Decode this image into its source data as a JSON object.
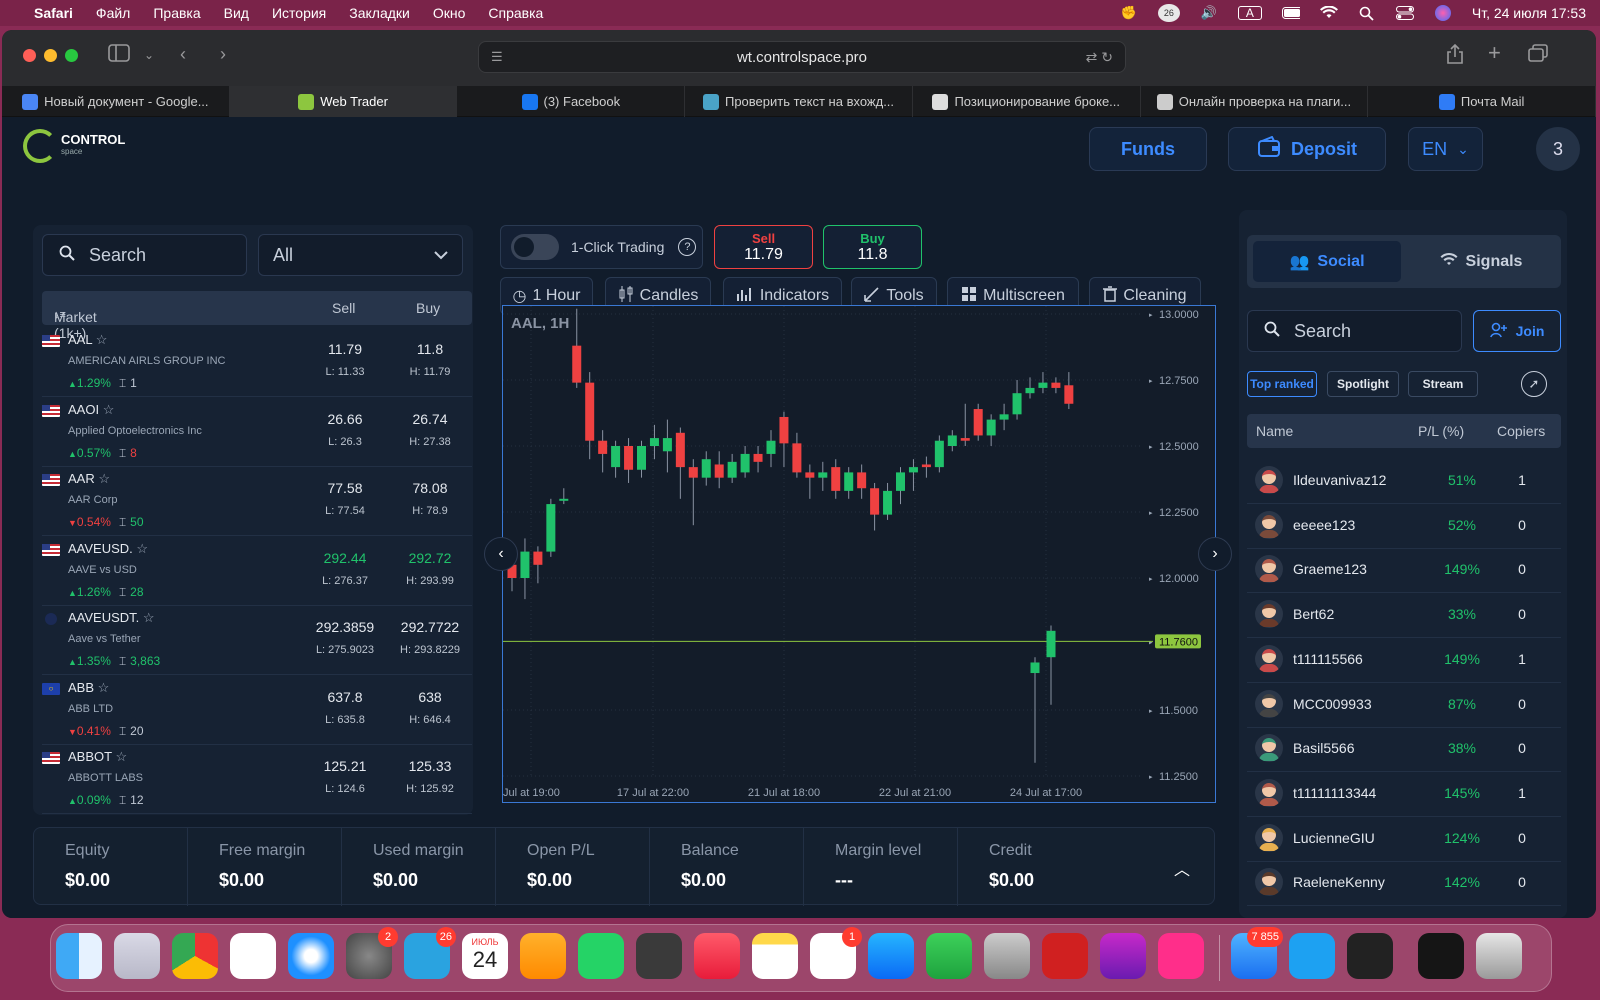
{
  "menubar": {
    "app": "Safari",
    "items": [
      "Файл",
      "Правка",
      "Вид",
      "История",
      "Закладки",
      "Окно",
      "Справка"
    ],
    "datetime": "Чт, 24 июля  17:53",
    "input_source": "A"
  },
  "browser": {
    "url": "wt.controlspace.pro",
    "tabs": [
      {
        "label": "Новый документ - Google...",
        "active": false,
        "color": "#4a86f5"
      },
      {
        "label": "Web Trader",
        "active": true,
        "color": "#8dc63f"
      },
      {
        "label": "(3) Facebook",
        "active": false,
        "color": "#1877f2"
      },
      {
        "label": "Проверить текст на вхожд...",
        "active": false,
        "color": "#4aa3c7"
      },
      {
        "label": "Позиционирование броке...",
        "active": false,
        "color": "#dddddd"
      },
      {
        "label": "Онлайн проверка на плаги...",
        "active": false,
        "color": "#cccccc"
      },
      {
        "label": "Почта Mail",
        "active": false,
        "color": "#2f7cf6"
      }
    ]
  },
  "header": {
    "logo_text": "CONTROL",
    "logo_sub": "space",
    "funds_label": "Funds",
    "deposit_label": "Deposit",
    "lang_label": "EN",
    "avatar_label": "3"
  },
  "market": {
    "search_placeholder": "Search",
    "filter_value": "All",
    "col_market": "Market (1k+)",
    "col_sell": "Sell",
    "col_buy": "Buy",
    "rows": [
      {
        "symbol": "AAL",
        "name": "AMERICAN AIRLS GROUP INC",
        "change": "1.29%",
        "dir": "up",
        "count": "1",
        "count_color": "#c0c8d4",
        "sell": "11.79",
        "buy": "11.8",
        "low": "L: 11.33",
        "high": "H: 11.79",
        "price_color": "#e4e8ee",
        "flag": "us"
      },
      {
        "symbol": "AAOI",
        "name": "Applied Optoelectronics Inc",
        "change": "0.57%",
        "dir": "up",
        "count": "8",
        "count_color": "#ef4141",
        "sell": "26.66",
        "buy": "26.74",
        "low": "L: 26.3",
        "high": "H: 27.38",
        "price_color": "#e4e8ee",
        "flag": "us"
      },
      {
        "symbol": "AAR",
        "name": "AAR Corp",
        "change": "0.54%",
        "dir": "down",
        "count": "50",
        "count_color": "#20c26b",
        "sell": "77.58",
        "buy": "78.08",
        "low": "L: 77.54",
        "high": "H: 78.9",
        "price_color": "#e4e8ee",
        "flag": "us"
      },
      {
        "symbol": "AAVEUSD.",
        "name": "AAVE vs USD",
        "change": "1.26%",
        "dir": "up",
        "count": "28",
        "count_color": "#20c26b",
        "sell": "292.44",
        "buy": "292.72",
        "low": "L: 276.37",
        "high": "H: 293.99",
        "price_color": "#20c26b",
        "flag": "us"
      },
      {
        "symbol": "AAVEUSDT.",
        "name": "Aave vs Tether",
        "change": "1.35%",
        "dir": "up",
        "count": "3,863",
        "count_color": "#20c26b",
        "sell": "292.3859",
        "buy": "292.7722",
        "low": "L: 275.9023",
        "high": "H: 293.8229",
        "price_color": "#e4e8ee",
        "flag": "crypto"
      },
      {
        "symbol": "ABB",
        "name": "ABB LTD",
        "change": "0.41%",
        "dir": "down",
        "count": "20",
        "count_color": "#c0c8d4",
        "sell": "637.8",
        "buy": "638",
        "low": "L: 635.8",
        "high": "H: 646.4",
        "price_color": "#e4e8ee",
        "flag": "eu"
      },
      {
        "symbol": "ABBOT",
        "name": "ABBOTT LABS",
        "change": "0.09%",
        "dir": "up",
        "count": "12",
        "count_color": "#c0c8d4",
        "sell": "125.21",
        "buy": "125.33",
        "low": "L: 124.6",
        "high": "H: 125.92",
        "price_color": "#e4e8ee",
        "flag": "us"
      }
    ]
  },
  "trade": {
    "one_click_label": "1-Click Trading",
    "one_click_enabled": false,
    "sell_label": "Sell",
    "sell_price": "11.79",
    "buy_label": "Buy",
    "buy_price": "11.8",
    "tools": [
      "1 Hour",
      "Candles",
      "Indicators",
      "Tools",
      "Multiscreen",
      "Cleaning"
    ]
  },
  "chart_data": {
    "type": "candlestick",
    "title": "AAL, 1H",
    "y_ticks": [
      "13.0000",
      "12.7500",
      "12.5000",
      "12.2500",
      "12.0000",
      "11.7600",
      "11.5000",
      "11.2500"
    ],
    "ylim": [
      11.25,
      13.0
    ],
    "x_ticks": [
      "Jul at 19:00",
      "17 Jul at 22:00",
      "21 Jul at 18:00",
      "22 Jul at 21:00",
      "24 Jul at 17:00"
    ],
    "current_price": 11.76,
    "current_price_label": "11.7600",
    "up_color": "#20c26b",
    "down_color": "#ef4141",
    "candles": [
      [
        12.05,
        12.0,
        12.08,
        11.95
      ],
      [
        12.0,
        12.1,
        12.15,
        11.92
      ],
      [
        12.1,
        12.05,
        12.12,
        11.98
      ],
      [
        12.1,
        12.28,
        12.3,
        12.08
      ],
      [
        12.3,
        12.3,
        12.34,
        12.28
      ],
      [
        12.88,
        12.74,
        13.02,
        12.72
      ],
      [
        12.74,
        12.52,
        12.78,
        12.45
      ],
      [
        12.52,
        12.47,
        12.56,
        12.4
      ],
      [
        12.42,
        12.5,
        12.52,
        12.38
      ],
      [
        12.5,
        12.41,
        12.53,
        12.36
      ],
      [
        12.41,
        12.5,
        12.52,
        12.38
      ],
      [
        12.5,
        12.53,
        12.58,
        12.45
      ],
      [
        12.48,
        12.53,
        12.6,
        12.4
      ],
      [
        12.55,
        12.42,
        12.57,
        12.3
      ],
      [
        12.42,
        12.38,
        12.45,
        12.2
      ],
      [
        12.38,
        12.45,
        12.48,
        12.35
      ],
      [
        12.43,
        12.38,
        12.48,
        12.34
      ],
      [
        12.38,
        12.44,
        12.47,
        12.36
      ],
      [
        12.4,
        12.47,
        12.5,
        12.38
      ],
      [
        12.47,
        12.44,
        12.5,
        12.4
      ],
      [
        12.47,
        12.52,
        12.56,
        12.42
      ],
      [
        12.61,
        12.51,
        12.63,
        12.42
      ],
      [
        12.51,
        12.4,
        12.55,
        12.38
      ],
      [
        12.4,
        12.38,
        12.43,
        12.3
      ],
      [
        12.38,
        12.4,
        12.44,
        12.33
      ],
      [
        12.42,
        12.33,
        12.45,
        12.3
      ],
      [
        12.33,
        12.4,
        12.42,
        12.3
      ],
      [
        12.4,
        12.34,
        12.43,
        12.3
      ],
      [
        12.34,
        12.24,
        12.36,
        12.18
      ],
      [
        12.24,
        12.33,
        12.36,
        12.22
      ],
      [
        12.33,
        12.4,
        12.42,
        12.28
      ],
      [
        12.4,
        12.42,
        12.45,
        12.33
      ],
      [
        12.43,
        12.42,
        12.46,
        12.38
      ],
      [
        12.42,
        12.52,
        12.54,
        12.4
      ],
      [
        12.5,
        12.54,
        12.56,
        12.48
      ],
      [
        12.53,
        12.52,
        12.66,
        12.5
      ],
      [
        12.64,
        12.54,
        12.66,
        12.52
      ],
      [
        12.54,
        12.6,
        12.62,
        12.5
      ],
      [
        12.6,
        12.62,
        12.66,
        12.56
      ],
      [
        12.62,
        12.7,
        12.75,
        12.6
      ],
      [
        12.7,
        12.72,
        12.76,
        12.68
      ],
      [
        12.72,
        12.74,
        12.78,
        12.7
      ],
      [
        12.74,
        12.72,
        12.76,
        12.7
      ],
      [
        12.73,
        12.66,
        12.78,
        12.64
      ],
      [
        11.64,
        11.68,
        11.7,
        11.3
      ],
      [
        11.7,
        11.8,
        11.82,
        11.52
      ]
    ]
  },
  "footer": {
    "items": [
      {
        "label": "Equity",
        "value": "$0.00"
      },
      {
        "label": "Free margin",
        "value": "$0.00"
      },
      {
        "label": "Used margin",
        "value": "$0.00"
      },
      {
        "label": "Open P/L",
        "value": "$0.00"
      },
      {
        "label": "Balance",
        "value": "$0.00"
      },
      {
        "label": "Margin level",
        "value": "---"
      },
      {
        "label": "Credit",
        "value": "$0.00"
      }
    ]
  },
  "social": {
    "tab_social": "Social",
    "tab_signals": "Signals",
    "search_placeholder": "Search",
    "join_label": "Join",
    "filters": [
      "Top ranked",
      "Spotlight",
      "Stream"
    ],
    "col_name": "Name",
    "col_pl": "P/L (%)",
    "col_copiers": "Copiers",
    "traders": [
      {
        "name": "Ildeuvanivaz12",
        "pl": "51%",
        "copiers": "1"
      },
      {
        "name": "eeeee123",
        "pl": "52%",
        "copiers": "0"
      },
      {
        "name": "Graeme123",
        "pl": "149%",
        "copiers": "0"
      },
      {
        "name": "Bert62",
        "pl": "33%",
        "copiers": "0"
      },
      {
        "name": "t111115566",
        "pl": "149%",
        "copiers": "1"
      },
      {
        "name": "MCC009933",
        "pl": "87%",
        "copiers": "0"
      },
      {
        "name": "Basil5566",
        "pl": "38%",
        "copiers": "0"
      },
      {
        "name": "t11111113344",
        "pl": "145%",
        "copiers": "1"
      },
      {
        "name": "LucienneGIU",
        "pl": "124%",
        "copiers": "0"
      },
      {
        "name": "RaeleneKenny",
        "pl": "142%",
        "copiers": "0"
      }
    ]
  },
  "dock": {
    "calendar_month": "ИЮЛЬ",
    "calendar_day": "24",
    "badges": {
      "settings": "2",
      "telegram": "26",
      "reminders": "1",
      "mail": "7 855"
    },
    "status_badge": "26"
  }
}
